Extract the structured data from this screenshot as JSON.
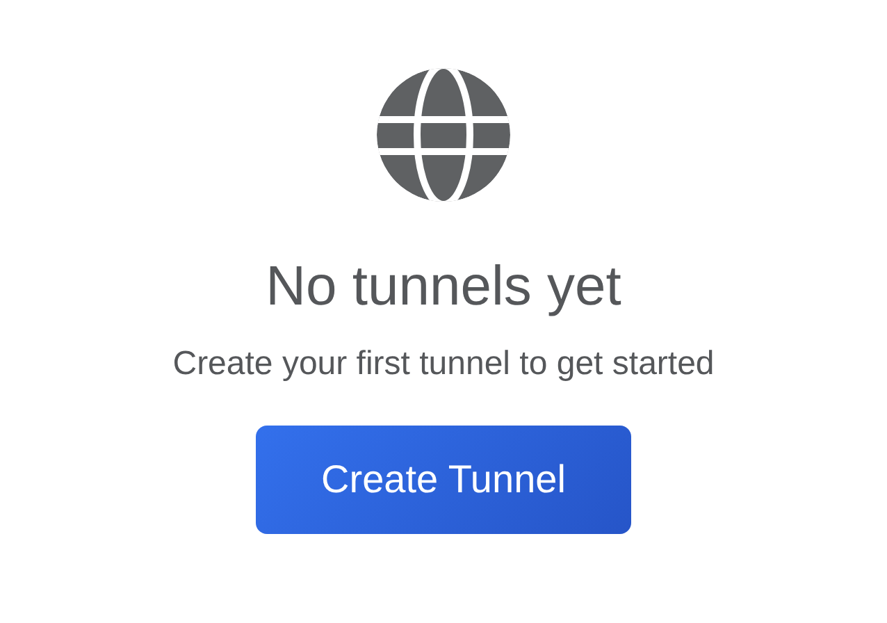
{
  "empty_state": {
    "title": "No tunnels yet",
    "message": "Create your first tunnel to get started",
    "button": "Create Tunnel"
  }
}
